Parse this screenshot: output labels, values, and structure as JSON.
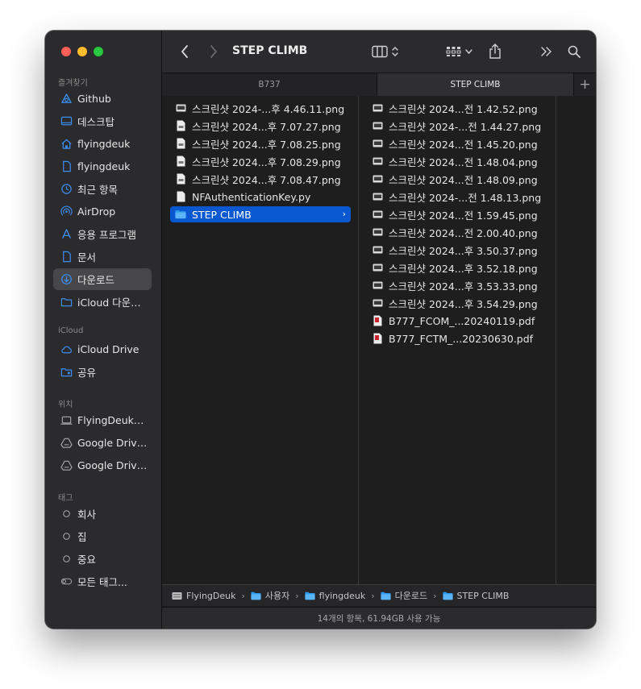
{
  "window": {
    "title": "STEP CLIMB"
  },
  "sidebar": {
    "sections": [
      {
        "label": "즐겨찾기",
        "items": [
          {
            "label": "Github",
            "icon": "cloud-folder-icon"
          },
          {
            "label": "데스크탑",
            "icon": "desktop-icon"
          },
          {
            "label": "flyingdeuk",
            "icon": "home-icon"
          },
          {
            "label": "flyingdeuk",
            "icon": "document-icon"
          },
          {
            "label": "최근 항목",
            "icon": "clock-icon"
          },
          {
            "label": "AirDrop",
            "icon": "airdrop-icon"
          },
          {
            "label": "응용 프로그램",
            "icon": "applications-icon"
          },
          {
            "label": "문서",
            "icon": "document-icon"
          },
          {
            "label": "다운로드",
            "icon": "download-icon",
            "selected": true
          },
          {
            "label": "iCloud 다운…",
            "icon": "folder-icon"
          }
        ]
      },
      {
        "label": "iCloud",
        "items": [
          {
            "label": "iCloud Drive",
            "icon": "icloud-icon"
          },
          {
            "label": "공유",
            "icon": "shared-folder-icon"
          }
        ]
      },
      {
        "label": "위치",
        "items": [
          {
            "label": "FlyingDeuk…",
            "icon": "laptop-icon"
          },
          {
            "label": "Google Driv…",
            "icon": "drive-icon"
          },
          {
            "label": "Google Driv…",
            "icon": "drive-icon"
          }
        ]
      },
      {
        "label": "태그",
        "items": [
          {
            "label": "회사",
            "icon": "tag-circle-icon"
          },
          {
            "label": "집",
            "icon": "tag-circle-icon"
          },
          {
            "label": "중요",
            "icon": "tag-circle-icon"
          },
          {
            "label": "모든 태그...",
            "icon": "all-tags-icon"
          }
        ]
      }
    ]
  },
  "tabs": [
    {
      "label": "B737",
      "active": false
    },
    {
      "label": "STEP CLIMB",
      "active": true
    }
  ],
  "column1": [
    {
      "name": "스크린샷 2024-...후 4.46.11.png",
      "icon": "screenshot-icon"
    },
    {
      "name": "스크린샷 2024...후 7.07.27.png",
      "icon": "image-doc-icon"
    },
    {
      "name": "스크린샷 2024...후 7.08.25.png",
      "icon": "image-doc-icon"
    },
    {
      "name": "스크린샷 2024...후 7.08.29.png",
      "icon": "image-doc-icon"
    },
    {
      "name": "스크린샷 2024...후 7.08.47.png",
      "icon": "image-doc-icon"
    },
    {
      "name": "NFAuthenticationKey.py",
      "icon": "python-file-icon"
    },
    {
      "name": "STEP CLIMB",
      "icon": "folder-icon",
      "selected": true,
      "chevron": "›"
    }
  ],
  "column2": [
    {
      "name": "스크린샷 2024...전 1.42.52.png",
      "icon": "screenshot-icon"
    },
    {
      "name": "스크린샷 2024-...전 1.44.27.png",
      "icon": "screenshot-icon"
    },
    {
      "name": "스크린샷 2024...전 1.45.20.png",
      "icon": "screenshot-icon"
    },
    {
      "name": "스크린샷 2024...전 1.48.04.png",
      "icon": "screenshot-icon"
    },
    {
      "name": "스크린샷 2024...전 1.48.09.png",
      "icon": "screenshot-icon"
    },
    {
      "name": "스크린샷 2024-...전 1.48.13.png",
      "icon": "screenshot-icon"
    },
    {
      "name": "스크린샷 2024...전 1.59.45.png",
      "icon": "screenshot-icon"
    },
    {
      "name": "스크린샷 2024...전 2.00.40.png",
      "icon": "screenshot-icon"
    },
    {
      "name": "스크린샷 2024...후 3.50.37.png",
      "icon": "screenshot-icon"
    },
    {
      "name": "스크린샷 2024...후 3.52.18.png",
      "icon": "screenshot-icon"
    },
    {
      "name": "스크린샷 2024...후 3.53.33.png",
      "icon": "screenshot-icon"
    },
    {
      "name": "스크린샷 2024...후 3.54.29.png",
      "icon": "screenshot-icon"
    },
    {
      "name": "B777_FCOM_...20240119.pdf",
      "icon": "pdf-icon"
    },
    {
      "name": "B777_FCTM_...20230630.pdf",
      "icon": "pdf-icon"
    }
  ],
  "pathbar": [
    {
      "label": "FlyingDeuk",
      "icon": "hard-drive-icon"
    },
    {
      "label": "사용자",
      "icon": "folder-icon"
    },
    {
      "label": "flyingdeuk",
      "icon": "folder-icon"
    },
    {
      "label": "다운로드",
      "icon": "folder-icon"
    },
    {
      "label": "STEP CLIMB",
      "icon": "folder-icon"
    }
  ],
  "pathbar_separator": "›",
  "status": {
    "text": "14개의 항목, 61.94GB 사용 가능"
  },
  "colors": {
    "accent": "#0a58d0",
    "sidebar_icon": "#3b8ef0",
    "folder": "#2c9bf0"
  }
}
